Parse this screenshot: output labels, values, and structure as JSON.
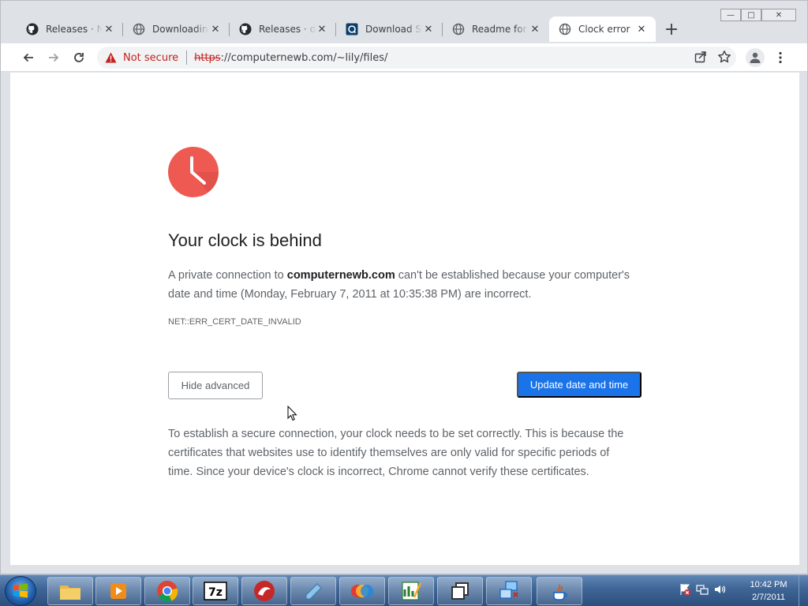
{
  "window_controls": {
    "minimize": "—",
    "maximize": "□",
    "close": "✕"
  },
  "tabs": [
    {
      "title": "Releases · Na",
      "icon": "github-icon",
      "active": false
    },
    {
      "title": "Downloading",
      "icon": "globe-icon",
      "active": false
    },
    {
      "title": "Releases · dn",
      "icon": "github-icon",
      "active": false
    },
    {
      "title": "Download St",
      "icon": "app-icon",
      "active": false
    },
    {
      "title": "Readme for",
      "icon": "globe-icon",
      "active": false
    },
    {
      "title": "Clock error",
      "icon": "globe-icon",
      "active": true
    }
  ],
  "tab_close": "✕",
  "new_tab": "+",
  "omnibox": {
    "security_label": "Not secure",
    "url_scheme": "https",
    "url_rest": "://computernewb.com/~lily/files/"
  },
  "page": {
    "headline": "Your clock is behind",
    "p1_before": "A private connection to ",
    "p1_domain": "computernewb.com",
    "p1_after": " can't be established because your computer's date and time (Monday, February 7, 2011 at 10:35:38 PM) are incorrect.",
    "error_code": "NET::ERR_CERT_DATE_INVALID",
    "hide_advanced": "Hide advanced",
    "update_button": "Update date and time",
    "explanation": "To establish a secure connection, your clock needs to be set correctly. This is because the certificates that websites use to identify themselves are only valid for specific periods of time. Since your device's clock is incorrect, Chrome cannot verify these certificates."
  },
  "colors": {
    "accent": "#1a73e8",
    "warning": "#c5221f",
    "clock": "#ee5a52"
  },
  "taskbar": {
    "items": [
      "file-explorer-icon",
      "media-player-icon",
      "chrome-icon",
      "7zip-icon",
      "app-red-icon",
      "notepad-icon",
      "paint-icon",
      "chart-icon",
      "window-switcher-icon",
      "network-tool-icon",
      "java-icon"
    ],
    "time": "10:42 PM",
    "date": "2/7/2011"
  }
}
